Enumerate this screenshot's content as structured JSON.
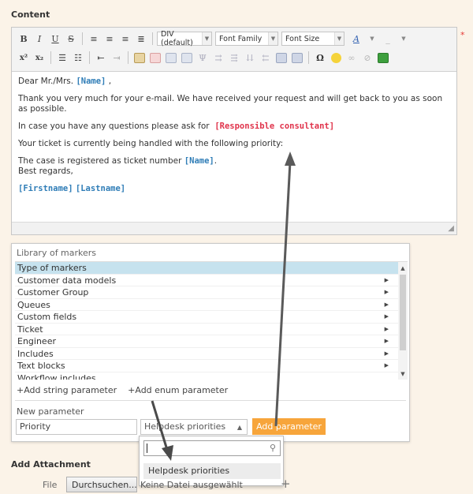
{
  "content": {
    "title": "Content",
    "required_marker": "*"
  },
  "toolbar": {
    "row1": {
      "bold": "B",
      "italic": "I",
      "underline": "U",
      "strike": "S",
      "format_combo": "DIV (default)",
      "font_family_combo": "Font Family",
      "font_size_combo": "Font Size",
      "text_color": "A"
    },
    "row2": {
      "superscript": "x²",
      "subscript": "x₂",
      "special_char": "Ω"
    },
    "colors": {
      "accent_orange": "#f7a53b",
      "marker_blue": "#2f7db7",
      "marker_red": "#e0334b",
      "selection": "#c6e2ee"
    }
  },
  "editor": {
    "greeting_prefix": "Dear Mr./Mrs.",
    "greeting_marker": "[Name]",
    "greeting_suffix": ",",
    "p2": "Thank you very much for your e-mail. We have received your request and will get back to you as soon as possible.",
    "p3_text": "In case you have any questions please ask for",
    "p3_marker": "[Responsible consultant]",
    "p4": "Your ticket is currently being handled with the following priority:",
    "p5_text": "The case is registered as ticket number",
    "p5_marker": "[Name]",
    "p5_suffix": ".",
    "p5_line2": "Best regards,",
    "p6_marker1": "[Firstname]",
    "p6_marker2": "[Lastname]"
  },
  "library": {
    "title": "Library of markers",
    "items": [
      "Type of markers",
      "Customer data models",
      "Customer Group",
      "Queues",
      "Custom fields",
      "Ticket",
      "Engineer",
      "Includes",
      "Text blocks",
      "Workflow includes"
    ],
    "add_string": "+Add string parameter",
    "add_enum": "+Add enum parameter",
    "new_parameter_label": "New parameter",
    "param_name_value": "Priority",
    "param_type_value": "Helpdesk priorities",
    "add_parameter_button": "Add parameter"
  },
  "dropdown": {
    "option": "Helpdesk priorities"
  },
  "attachment": {
    "title": "Add Attachment",
    "file_label": "File",
    "browse_button": "Durchsuchen...",
    "file_name": "Keine Datei ausgewählt."
  }
}
